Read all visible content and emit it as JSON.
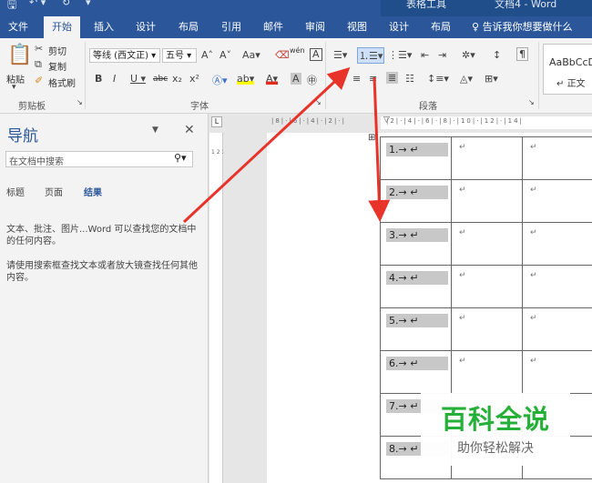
{
  "titlebar": {
    "context": "表格工具",
    "doc_title": "文档4 - Word"
  },
  "menu": {
    "tabs": [
      "文件",
      "开始",
      "插入",
      "设计",
      "布局",
      "引用",
      "邮件",
      "审阅",
      "视图",
      "设计",
      "布局"
    ],
    "tell_me": "告诉我你想要做什么"
  },
  "ribbon": {
    "clipboard": {
      "paste": "粘贴",
      "cut": "剪切",
      "copy": "复制",
      "painter": "格式刷",
      "group": "剪贴板"
    },
    "font": {
      "name": "等线 (西文正)",
      "size": "五号",
      "group": "字体",
      "clear": "abc",
      "wen": "wén"
    },
    "paragraph": {
      "group": "段落"
    },
    "styles": {
      "preview": "AaBbCcD",
      "normal": "正文"
    }
  },
  "nav": {
    "title": "导航",
    "search_placeholder": "在文档中搜索",
    "tabs": [
      "标题",
      "页面",
      "结果"
    ],
    "msg1": "文本、批注、图片...Word 可以查找您的文档中的任何内容。",
    "msg2": "请使用搜索框查找文本或者放大镜查找任何其他内容。"
  },
  "table": {
    "rows": [
      "1.→ ↵",
      "2.→ ↵",
      "3.→ ↵",
      "4.→ ↵",
      "5.→ ↵",
      "6.→ ↵",
      "7.→ ↵",
      "8.→ ↵"
    ],
    "empty_mark": "↵"
  },
  "watermark": {
    "title": "百科全说",
    "subtitle": "助你轻松解决"
  },
  "colors": {
    "accent": "#2b579a",
    "arrow": "#e8332a",
    "watermark": "#27b039"
  }
}
